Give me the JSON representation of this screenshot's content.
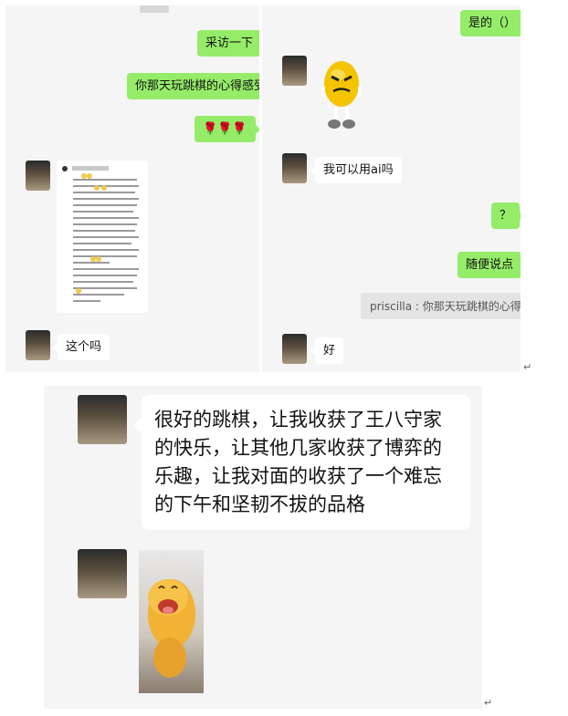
{
  "left_chat": {
    "messages": [
      {
        "text": "采访一下"
      },
      {
        "text": "你那天玩跳棋的心得感受"
      },
      {
        "text": "🌹🌹🌹"
      },
      {
        "text": "这个吗"
      }
    ]
  },
  "right_chat": {
    "messages": [
      {
        "text": "是的（）"
      },
      {
        "text": "我可以用ai吗"
      },
      {
        "text": "？"
      },
      {
        "text": "随便说点"
      },
      {
        "text": "好"
      }
    ],
    "quote": "priscilla : 你那天玩跳棋的心得感受"
  },
  "bottom_chat": {
    "reply": "很好的跳棋，让我收获了王八守家\n的快乐，让其他几家收获了博弈的\n乐趣，让我对面的收获了一个难忘\n的下午和坚韧不拔的品格"
  },
  "return_mark": "↵",
  "colors": {
    "green_bubble": "#95ec69",
    "panel_bg": "#f5f5f5",
    "quote_bg": "#e4e4e4"
  }
}
